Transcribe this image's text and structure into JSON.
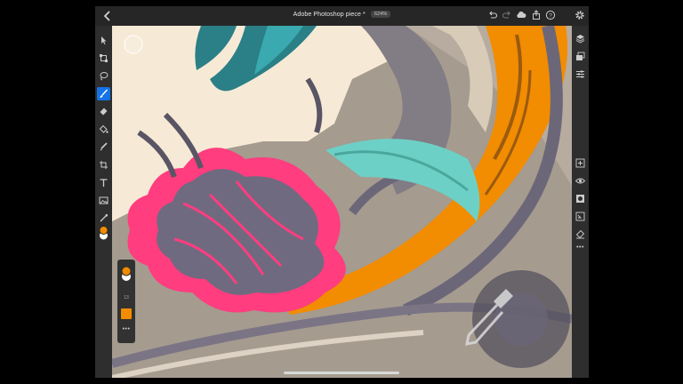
{
  "header": {
    "document_title": "Adobe Photoshop piece *",
    "zoom_level": "624%"
  },
  "colors": {
    "foreground": "#f28c00",
    "background": "#ffffff",
    "accent": "#1473e6"
  },
  "brush_panel": {
    "size_value": "13",
    "swatch_color": "#f28c00"
  },
  "left_toolbar": {
    "tools": [
      "move-icon",
      "transform-icon",
      "lasso-icon",
      "brush-icon",
      "eraser-icon",
      "fill-icon",
      "smudge-icon",
      "crop-icon",
      "type-icon",
      "image-icon",
      "eyedropper-icon"
    ],
    "active": "brush-icon"
  },
  "right_toolbar": {
    "tools": [
      "layers-icon",
      "layer-stack-icon",
      "properties-icon",
      "add-layer-icon",
      "visibility-icon",
      "mask-icon",
      "clip-icon",
      "clear-icon",
      "more-icon"
    ]
  }
}
